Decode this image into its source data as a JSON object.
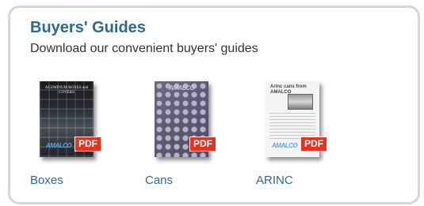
{
  "panel": {
    "title": "Buyers' Guides",
    "subtitle": "Download our convenient buyers' guides"
  },
  "guides": [
    {
      "label": "Boxes",
      "badge": "PDF",
      "cover_text": "ALUMINUM BOXES and COVERS",
      "cover_logo": "AMALCO"
    },
    {
      "label": "Cans",
      "badge": "PDF",
      "cover_logo": "AMALCO"
    },
    {
      "label": "ARINC",
      "badge": "PDF",
      "cover_text": "Arinc cans from AMALCO",
      "cover_logo": "AMALCO"
    }
  ],
  "colors": {
    "title": "#2d6a8f",
    "link": "#2d6a8f",
    "pdf_badge": "#e8321e",
    "panel_border": "#d6d6d6"
  }
}
